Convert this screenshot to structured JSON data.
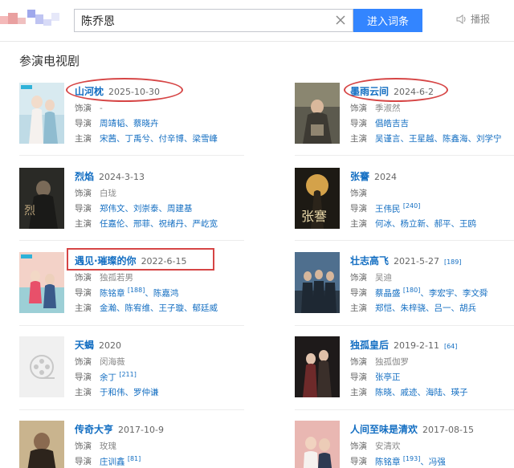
{
  "search": {
    "value": "陈乔恩",
    "button": "进入词条",
    "speak": "播报"
  },
  "section_title": "参演电视剧",
  "labels": {
    "role": "饰演",
    "director": "导演",
    "cast": "主演"
  },
  "items": [
    {
      "title": "山河枕",
      "date": "2025-10-30",
      "sup": "",
      "role": "-",
      "directors": "周靖韬、蔡晓卉",
      "cast": "宋茜、丁禹兮、付辛博、梁雪峰"
    },
    {
      "title": "墨雨云间",
      "date": "2024-6-2",
      "sup": "",
      "role": "季淑然",
      "directors": "倡皓吉吉",
      "cast": "吴谨言、王星越、陈鑫海、刘学宁"
    },
    {
      "title": "烈焰",
      "date": "2024-3-13",
      "sup": "",
      "role": "白珑",
      "directors": "郑伟文、刘崇泰、周建基",
      "cast": "任嘉伦、邢菲、祝绪丹、严屹宽"
    },
    {
      "title": "张謇",
      "date": "2024",
      "sup": "",
      "role": "",
      "directors": "王伟民",
      "directors_sup": "[240]",
      "cast": "何冰、杨立新、郝平、王鸥"
    },
    {
      "title": "遇见·璀璨的你",
      "date": "2022-6-15",
      "sup": "",
      "role": "独孤若男",
      "directors": "陈铭章",
      "directors_sup": "[188]",
      "directors2": "、陈嘉鸿",
      "cast": "金瀚、陈宥维、王子璇、郁廷威"
    },
    {
      "title": "壮志高飞",
      "date": "2021-5-27",
      "sup": "[189]",
      "role": "吴迪",
      "directors": "蔡晶盛",
      "directors_sup": "[180]",
      "directors2": "、李宏宇、李文舜",
      "cast": "郑恺、朱梓骁、吕一、胡兵"
    },
    {
      "title": "天蝎",
      "date": "2020",
      "sup": "",
      "role": "闵海薇",
      "directors": "余丁",
      "directors_sup": "[211]",
      "cast": "于和伟、罗仲谦"
    },
    {
      "title": "独孤皇后",
      "date": "2019-2-11",
      "sup": "[64]",
      "role": "独孤伽罗",
      "directors": "张亭正",
      "cast": "陈晓、戚迹、海陆、瑛子"
    },
    {
      "title": "传奇大亨",
      "date": "2017-10-9",
      "sup": "",
      "role": "玫瑰",
      "directors": "庄训鑫",
      "directors_sup": "[81]",
      "cast": ""
    },
    {
      "title": "人间至味是清欢",
      "date": "2017-08-15",
      "sup": "",
      "role": "安清欢",
      "directors": "陈铭章",
      "directors_sup": "[193]",
      "directors2": "、冯强",
      "cast": ""
    }
  ],
  "colors": {
    "link": "#136ec2",
    "accent": "#3385ff",
    "highlight": "#d64545"
  }
}
